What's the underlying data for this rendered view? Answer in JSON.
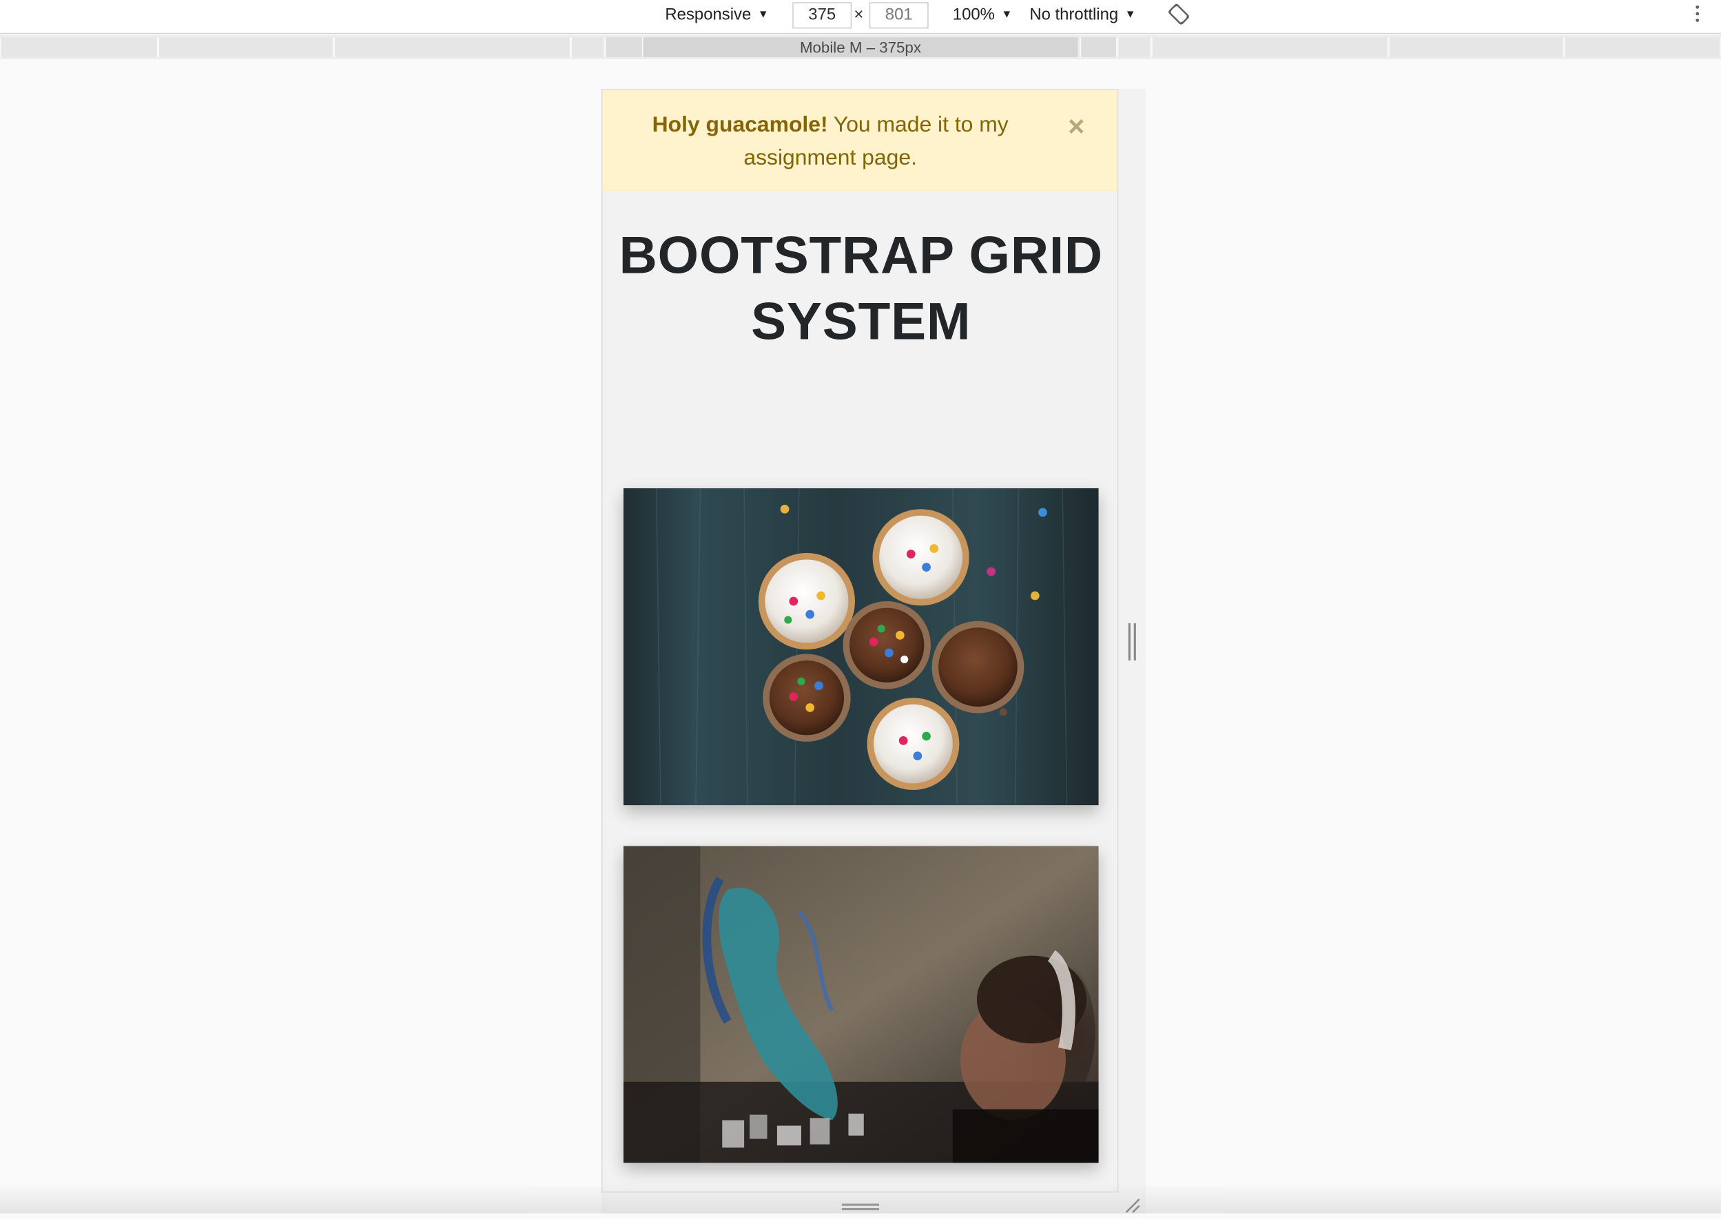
{
  "devtools": {
    "device_mode": "Responsive",
    "width": "375",
    "height": "801",
    "times": "×",
    "zoom": "100%",
    "throttling": "No throttling",
    "caret": "▼",
    "media_query_label": "Mobile M – 375px"
  },
  "alert": {
    "strong": "Holy guacamole!",
    "text": " You made it to my assignment page.",
    "close": "×",
    "background": "#fff3cd",
    "text_color": "#856404"
  },
  "page": {
    "title": "BOOTSTRAP GRID SYSTEM",
    "background": "#f2f2f2"
  },
  "images": [
    {
      "subject": "cupcakes with sprinkles on dark wooden table"
    },
    {
      "subject": "graffiti mural wall with blurred woman wearing headphones"
    }
  ],
  "icons": {
    "rotate": "rotate-device-icon",
    "more": "more-options-icon",
    "close": "close-icon"
  }
}
